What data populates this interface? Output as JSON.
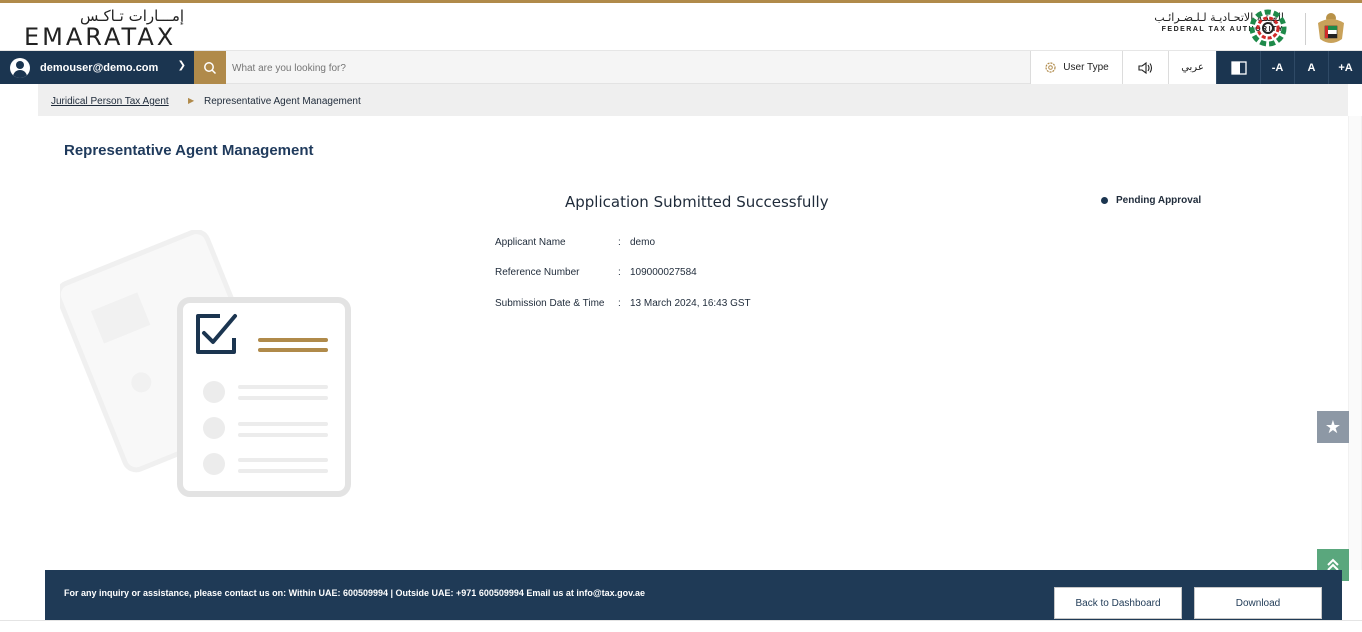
{
  "header": {
    "logo_arabic": "إمـــارات تـاكـس",
    "logo_english": "EMARATAX",
    "authority_arabic": "الهيئـة الاتحـاديـة لـلـضـرائـب",
    "authority_english": "FEDERAL TAX AUTHORITY"
  },
  "navbar": {
    "user_email": "demouser@demo.com",
    "search_placeholder": "What are you looking for?",
    "user_type_label": "User Type",
    "arabic_toggle": "عربي",
    "font_decrease": "-A",
    "font_reset": "A",
    "font_increase": "+A"
  },
  "breadcrumb": {
    "parent": "Juridical Person Tax Agent",
    "current": "Representative Agent Management"
  },
  "page": {
    "title": "Representative Agent Management",
    "success_heading": "Application Submitted Successfully",
    "status": "Pending Approval"
  },
  "details": [
    {
      "label": "Applicant Name",
      "value": "demo"
    },
    {
      "label": "Reference Number",
      "value": "109000027584"
    },
    {
      "label": "Submission Date & Time",
      "value": "13 March 2024, 16:43 GST"
    }
  ],
  "footer": {
    "contact_text": "For any inquiry or assistance, please contact us on: Within UAE: 600509994 | Outside UAE: +971 600509994 Email us at info@tax.gov.ae",
    "back_button": "Back to Dashboard",
    "download_button": "Download"
  },
  "colors": {
    "navy": "#1b3550",
    "gold": "#b08a4a",
    "green": "#5aa77d"
  },
  "icons": {
    "search": "search-icon",
    "user_type": "gear-icon",
    "audio": "speaker-icon",
    "contrast": "contrast-icon",
    "favourite": "star-icon",
    "scroll_top": "double-chevron-up-icon"
  }
}
